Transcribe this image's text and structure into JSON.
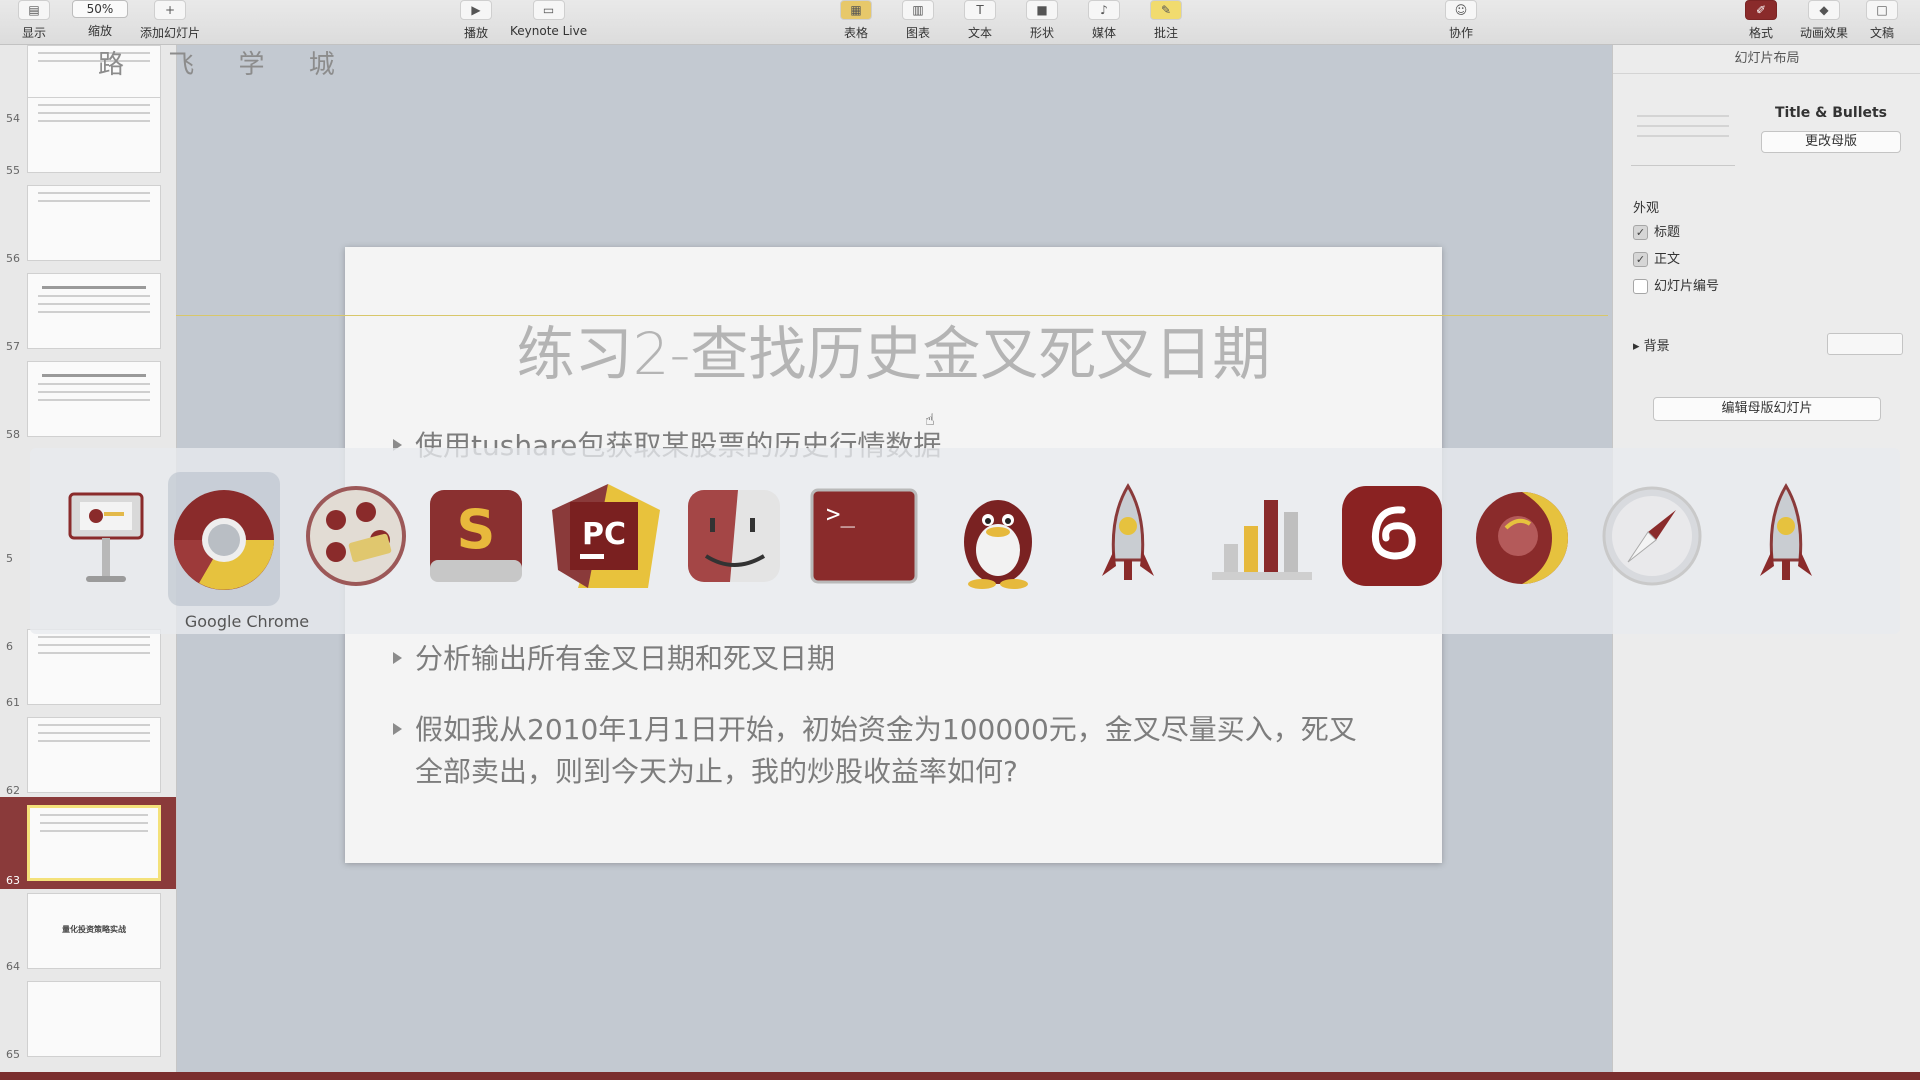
{
  "toolbar": {
    "view": "显示",
    "zoom_value": "50%",
    "zoom": "缩放",
    "add_slide": "添加幻灯片",
    "play": "播放",
    "keynote_live": "Keynote Live",
    "table": "表格",
    "chart": "图表",
    "text": "文本",
    "shape": "形状",
    "media": "媒体",
    "comment": "批注",
    "collaborate": "协作",
    "format": "格式",
    "animate": "动画效果",
    "document": "文稿"
  },
  "watermark": "路 飞 学 城",
  "navigator": {
    "slides": [
      {
        "num": "54"
      },
      {
        "num": "55"
      },
      {
        "num": "56"
      },
      {
        "num": "57"
      },
      {
        "num": "58"
      },
      {
        "num": "5"
      },
      {
        "num": "6"
      },
      {
        "num": "61"
      },
      {
        "num": "62"
      },
      {
        "num": "63"
      },
      {
        "num": "64"
      },
      {
        "num": "65"
      }
    ],
    "slide64_caption": "量化投资策略实战"
  },
  "slide": {
    "title": "练习2-查找历史金叉死叉日期",
    "bullets": [
      "使用tushare包获取某股票的历史行情数据",
      "分析输出所有金叉日期和死叉日期",
      "假如我从2010年1月1日开始，初始资金为100000元，金叉尽量买入，死叉全部卖出，则到今天为止，我的炒股收益率如何?"
    ]
  },
  "inspector": {
    "header": "幻灯片布局",
    "master_name": "Title & Bullets",
    "change_master": "更改母版",
    "appearance": "外观",
    "checkboxes": [
      {
        "label": "标题",
        "checked": true
      },
      {
        "label": "正文",
        "checked": true
      },
      {
        "label": "幻灯片编号",
        "checked": false
      }
    ],
    "background": "背景",
    "edit_master": "编辑母版幻灯片"
  },
  "dock": {
    "hovered_label": "Google Chrome",
    "apps": [
      "keynote-icon",
      "chrome-icon",
      "video-player-icon",
      "sublime-text-icon",
      "pycharm-icon",
      "finder-icon",
      "terminal-icon",
      "qq-icon",
      "launchpad-rocket-icon",
      "numbers-icon",
      "netease-music-icon",
      "firefox-icon",
      "safari-icon",
      "rocket-icon"
    ]
  },
  "colors": {
    "accent": "#8a2b2b",
    "selection": "#8a3a3a",
    "highlight": "#f4e17a"
  }
}
